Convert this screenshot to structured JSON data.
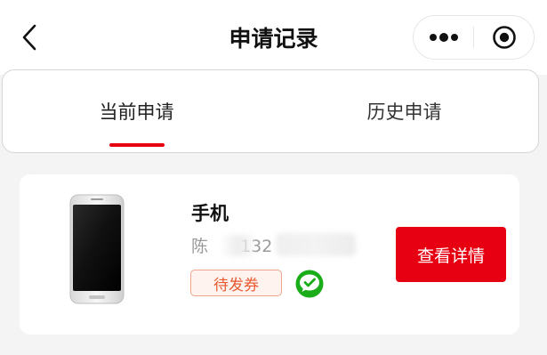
{
  "header": {
    "title": "申请记录",
    "back_icon": "chevron-left-icon",
    "more_icon": "more-dots-icon",
    "close_icon": "target-circle-icon"
  },
  "tabs": [
    {
      "label": "当前申请",
      "active": true
    },
    {
      "label": "历史申请",
      "active": false
    }
  ],
  "records": [
    {
      "product_name": "手机",
      "applicant": "陈",
      "phone": "132",
      "status": "待发券",
      "channel_icon": "wechat-icon",
      "detail_label": "查看详情"
    }
  ],
  "colors": {
    "accent": "#e60012",
    "badge_text": "#e85a30",
    "badge_border": "#f1a58e",
    "wechat_green": "#1aad19"
  }
}
